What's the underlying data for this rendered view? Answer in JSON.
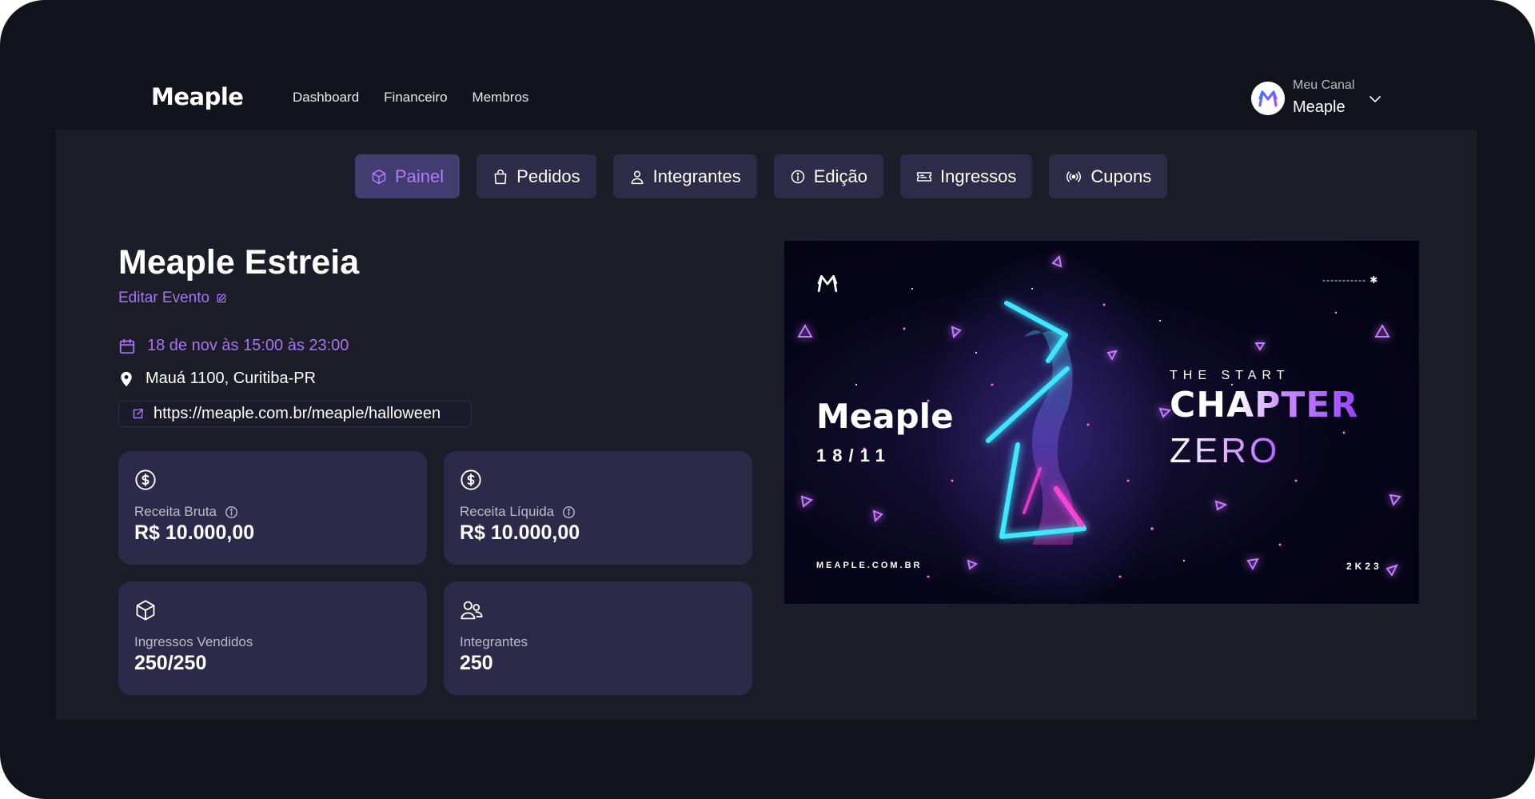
{
  "brand": {
    "logo_text": "Meaple"
  },
  "nav": {
    "items": [
      "Dashboard",
      "Financeiro",
      "Membros"
    ]
  },
  "account": {
    "label": "Meu Canal",
    "name": "Meaple"
  },
  "tabs": [
    {
      "label": "Painel",
      "icon": "cube-icon",
      "active": true
    },
    {
      "label": "Pedidos",
      "icon": "shopping-bag-icon",
      "active": false
    },
    {
      "label": "Integrantes",
      "icon": "user-icon",
      "active": false
    },
    {
      "label": "Edição",
      "icon": "info-icon",
      "active": false
    },
    {
      "label": "Ingressos",
      "icon": "ticket-icon",
      "active": false
    },
    {
      "label": "Cupons",
      "icon": "broadcast-icon",
      "active": false
    }
  ],
  "event": {
    "title": "Meaple Estreia",
    "edit_label": "Editar Evento",
    "date_text": "18 de nov às 15:00 às 23:00",
    "address": "Mauá 1100, Curitiba-PR",
    "url": "https://meaple.com.br/meaple/halloween"
  },
  "stats": [
    {
      "label": "Receita Bruta",
      "value": "R$ 10.000,00",
      "icon": "dollar-circle-icon",
      "has_info": true
    },
    {
      "label": "Receita Líquida",
      "value": "R$ 10.000,00",
      "icon": "dollar-circle-icon",
      "has_info": true
    },
    {
      "label": "Ingressos Vendidos",
      "value": "250/250",
      "icon": "box-icon",
      "has_info": false
    },
    {
      "label": "Integrantes",
      "value": "250",
      "icon": "users-icon",
      "has_info": false
    }
  ],
  "banner": {
    "brand": "Meaple",
    "date": "18/11",
    "tagline": "THE START",
    "headline": "CHAPTER",
    "headline2": "ZERO",
    "site": "MEAPLE.COM.BR",
    "year": "2K23",
    "corner_mark": "----------- ✱"
  },
  "colors": {
    "background": "#13131c",
    "panel": "#1d1d2a",
    "card": "#2c2a48",
    "tab": "#2e2b49",
    "tab_active": "#433c71",
    "accent": "#a277f0"
  }
}
